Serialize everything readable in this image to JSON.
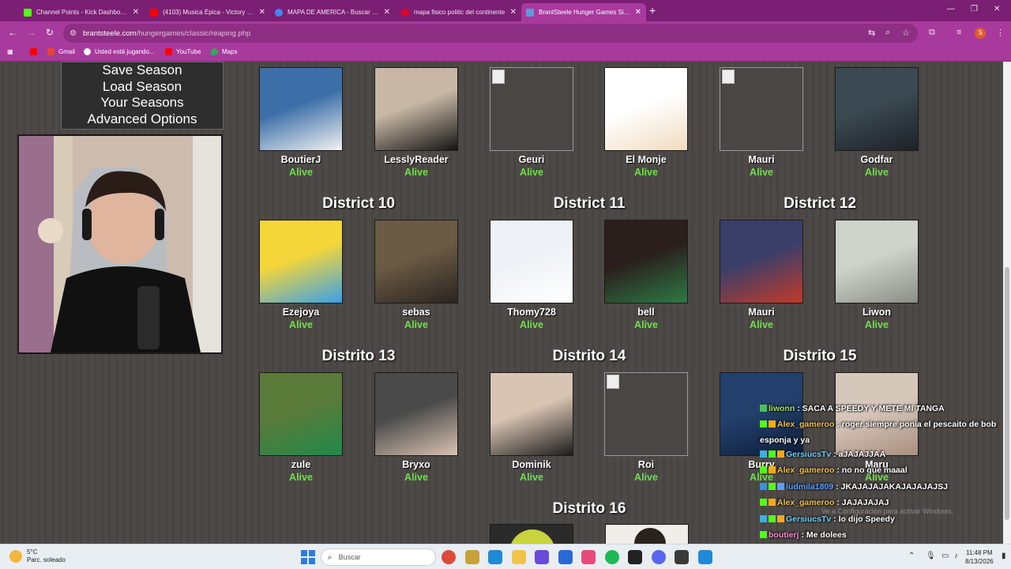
{
  "browser": {
    "tabs": [
      {
        "label": "Channel Points - Kick Dashboard",
        "color": "#53fc18"
      },
      {
        "label": "(4103) Musica Épica - Victory - YouTube",
        "color": "#ff0000"
      },
      {
        "label": "MAPA DE AMERICA - Buscar con Google",
        "color": "#4285f4"
      },
      {
        "label": "mapa fisico politic del continente",
        "color": "#e60023"
      },
      {
        "label": "BrantSteele Hunger Games Simulator",
        "color": "#5d9bd8"
      }
    ],
    "active_tab": 4,
    "new_tab": "+",
    "address": {
      "domain": "brantsteele.com",
      "path": "/hungergames/classic/reaping.php"
    },
    "bookmarks": [
      {
        "label": "",
        "color": "#ff0000"
      },
      {
        "label": "Gmail",
        "color": "#ea4335"
      },
      {
        "label": "Usted está jugando...",
        "color": "#ffffff"
      },
      {
        "label": "YouTube",
        "color": "#ff0000"
      },
      {
        "label": "Maps",
        "color": "#34a853"
      }
    ],
    "window_controls": [
      "—",
      "❐",
      "✕"
    ]
  },
  "menu": {
    "items": [
      "Save Season",
      "Load Season",
      "Your Seasons",
      "Advanced Options"
    ]
  },
  "districts": [
    {
      "label": "",
      "tributes": [
        {
          "name": "BoutierJ",
          "status": "Alive",
          "img": "#3c6fa8",
          "img2": "#f2f2f2"
        },
        {
          "name": "LesslyReader",
          "status": "Alive",
          "img": "#c7b7a4",
          "img2": "#151515"
        },
        {
          "name": "Geuri",
          "status": "Alive",
          "img": "",
          "img2": ""
        },
        {
          "name": "El Monje",
          "status": "Alive",
          "img": "#ffffff",
          "img2": "#f1dcc0"
        },
        {
          "name": "Mauri",
          "status": "Alive",
          "img": "",
          "img2": ""
        },
        {
          "name": "Godfar",
          "status": "Alive",
          "img": "#3b4a52",
          "img2": "#1c2226"
        }
      ]
    },
    {
      "label": "District 10",
      "label_b": "District 11",
      "label_c": "District 12",
      "tributes": [
        {
          "name": "Ezejoya",
          "status": "Alive",
          "img": "#f4d63a",
          "img2": "#3aa0e8"
        },
        {
          "name": "sebas",
          "status": "Alive",
          "img": "#6b5a44",
          "img2": "#2a2420"
        },
        {
          "name": "Thomy728",
          "status": "Alive",
          "img": "#eef2f6",
          "img2": "#ffffff"
        },
        {
          "name": "bell",
          "status": "Alive",
          "img": "#2a1f1c",
          "img2": "#2e7a46"
        },
        {
          "name": "Mauri",
          "status": "Alive",
          "img": "#3a3f6a",
          "img2": "#c23a2a"
        },
        {
          "name": "Liwon",
          "status": "Alive",
          "img": "#cfd3cc",
          "img2": "#8a8f86"
        }
      ]
    },
    {
      "label": "Distrito 13",
      "label_b": "Distrito 14",
      "label_c": "Distrito 15",
      "tributes": [
        {
          "name": "zule",
          "status": "Alive",
          "img": "#5a7a3a",
          "img2": "#1f8a4a"
        },
        {
          "name": "Bryxo",
          "status": "Alive",
          "img": "#4a4a4a",
          "img2": "#d9c2b0"
        },
        {
          "name": "Dominik",
          "status": "Alive",
          "img": "#d8c4b2",
          "img2": "#1c1c1c"
        },
        {
          "name": "Roi",
          "status": "Alive",
          "img": "",
          "img2": ""
        },
        {
          "name": "Burry",
          "status": "Alive",
          "img": "#22406b",
          "img2": "#0e1e3a"
        },
        {
          "name": "Maru",
          "status": "Alive",
          "img": "#d6c7bb",
          "img2": "#a88f7e"
        }
      ]
    }
  ],
  "district_16": "Distrito 16",
  "chat": [
    {
      "user": "liwonn",
      "text": ": SACA A SPEEDY Y METE MI TANGA",
      "color": "#a8e05a",
      "badges": [
        "#4ac05a"
      ]
    },
    {
      "user": "Alex_gameroo",
      "text": ": roger siempre ponia el pescaito de bob esponja y ya",
      "color": "#f2c14a",
      "badges": [
        "#53fc18",
        "#f2a91a"
      ]
    },
    {
      "user": "GersiucsTv",
      "text": ": aJAJAJJAA",
      "color": "#6fd0ff",
      "badges": [
        "#3bb0e0",
        "#53fc18",
        "#f2a91a"
      ]
    },
    {
      "user": "Alex_gameroo",
      "text": ": no no que maaal",
      "color": "#f2c14a",
      "badges": [
        "#53fc18",
        "#f2a91a"
      ]
    },
    {
      "user": "ludmila1809",
      "text": ": JKAJAJAJAKAJAJAJAJSJ",
      "color": "#5aa0ff",
      "badges": [
        "#3b8fe0",
        "#53fc18",
        "#5aa0ff"
      ]
    },
    {
      "user": "Alex_gameroo",
      "text": ": JAJAJAJAJ",
      "color": "#f2c14a",
      "badges": [
        "#53fc18",
        "#f2a91a"
      ]
    },
    {
      "user": "GersiucsTv",
      "text": ": lo dijo Speedy",
      "color": "#6fd0ff",
      "badges": [
        "#3bb0e0",
        "#53fc18",
        "#f2a91a"
      ]
    },
    {
      "user": "boutierj",
      "text": ": Me dolees",
      "color": "#ff8ad0",
      "badges": [
        "#53fc18"
      ]
    }
  ],
  "watermark": "Ve a Configuración para activar Windows.",
  "taskbar": {
    "weather_temp": "5°C",
    "weather_desc": "Parc. soleado",
    "search_placeholder": "Buscar",
    "time": "11:48 PM",
    "date": "8/13/2026",
    "apps": [
      "#dd4a3a",
      "#c9a13a",
      "#1f8ad8",
      "#f0c44a",
      "#6a4ad8",
      "#2a6ad8",
      "#e84a7a",
      "#1db954",
      "#222222",
      "#5865f2",
      "#3a3a3a",
      "#1f8ad8"
    ]
  }
}
